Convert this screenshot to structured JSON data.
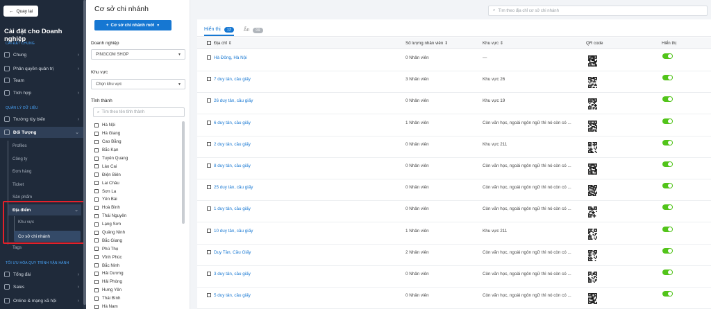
{
  "sidebar": {
    "back_label": "Quay lại",
    "title": "Cài đặt cho Doanh nghiệp",
    "section_general": "CÀI ĐẶT CHUNG",
    "general_items": [
      {
        "label": "Chung",
        "icon": "grid-icon"
      },
      {
        "label": "Phân quyền quản trị",
        "icon": "users-icon"
      },
      {
        "label": "Team",
        "icon": "team-icon"
      },
      {
        "label": "Tích hợp",
        "icon": "plug-icon"
      }
    ],
    "section_data": "QUẢN LÝ DỮ LIỆU",
    "data_items": [
      {
        "label": "Trường tùy biến",
        "icon": "field-icon"
      },
      {
        "label": "Đối Tượng",
        "icon": "box-icon"
      }
    ],
    "object_subitems": [
      "Profiles",
      "Công ty",
      "Đơn hàng",
      "Ticket",
      "Sản phẩm"
    ],
    "location_label": "Địa điểm",
    "location_subitems": [
      "Khu vực",
      "Cơ sở chi nhánh"
    ],
    "tags_label": "Tags",
    "section_ops": "TỐI ƯU HÓA QUY TRÌNH VẬN HÀNH",
    "ops_items": [
      {
        "label": "Tổng đài",
        "icon": "phone-icon"
      },
      {
        "label": "Sales",
        "icon": "sales-icon"
      },
      {
        "label": "Online & mạng xã hội",
        "icon": "globe-icon"
      }
    ]
  },
  "filter": {
    "title": "Cơ sở chi nhánh",
    "new_button": "Cơ sở chi nhánh mới",
    "company_label": "Doanh nghiệp",
    "company_value": "PINGCOM SHOP",
    "region_label": "Khu vực",
    "region_placeholder": "Chọn khu vực",
    "province_label": "Tỉnh thành",
    "province_search": "Tìm theo tên tỉnh thành",
    "provinces": [
      "Hà Nội",
      "Hà Giang",
      "Cao Bằng",
      "Bắc Kạn",
      "Tuyên Quang",
      "Lào Cai",
      "Điện Biên",
      "Lai Châu",
      "Sơn La",
      "Yên Bái",
      "Hoà Bình",
      "Thái Nguyên",
      "Lạng Sơn",
      "Quảng Ninh",
      "Bắc Giang",
      "Phú Thọ",
      "Vĩnh Phúc",
      "Bắc Ninh",
      "Hải Dương",
      "Hải Phòng",
      "Hưng Yên",
      "Thái Bình",
      "Hà Nam"
    ]
  },
  "main": {
    "search_placeholder": "Tìm theo địa chỉ cơ sở chi nhánh",
    "tabs": [
      {
        "label": "Hiển thị",
        "count": "13"
      },
      {
        "label": "Ẩn",
        "count": "09"
      }
    ],
    "columns": [
      "Địa chỉ",
      "Số lượng nhân viên",
      "Khu vực",
      "QR code",
      "Hiển thị"
    ],
    "rows": [
      {
        "address": "Hà Đông, Hà Nội",
        "employees": "0 Nhân viên",
        "area": "—",
        "visible": true
      },
      {
        "address": "7 duy tân, cầu giấy",
        "employees": "3 Nhân viên",
        "area": "Khu vực 26",
        "visible": true
      },
      {
        "address": "26 duy tân, cầu giấy",
        "employees": "0 Nhân viên",
        "area": "Khu vực 19",
        "visible": true
      },
      {
        "address": "6 duy tân, cầu giấy",
        "employees": "1 Nhân viên",
        "area": "Còn văn học, ngoài ngôn ngữ thì nó còn có ...",
        "visible": true
      },
      {
        "address": "2 duy tân, cầu giấy",
        "employees": "0 Nhân viên",
        "area": "Khu vực 211",
        "visible": true
      },
      {
        "address": "8 duy tân, cầu giấy",
        "employees": "0 Nhân viên",
        "area": "Còn văn học, ngoài ngôn ngữ thì nó còn có ...",
        "visible": true
      },
      {
        "address": "25 duy tân, cầu giấy",
        "employees": "0 Nhân viên",
        "area": "Còn văn học, ngoài ngôn ngữ thì nó còn có ...",
        "visible": true
      },
      {
        "address": "1 duy tân, cầu giấy",
        "employees": "0 Nhân viên",
        "area": "Còn văn học, ngoài ngôn ngữ thì nó còn có ...",
        "visible": true
      },
      {
        "address": "10 duy tân, cầu giấy",
        "employees": "1 Nhân viên",
        "area": "Khu vực 211",
        "visible": true
      },
      {
        "address": "Duy Tân, Cầu Giấy",
        "employees": "2 Nhân viên",
        "area": "Còn văn học, ngoài ngôn ngữ thì nó còn có ...",
        "visible": true
      },
      {
        "address": "3 duy tân, cầu giấy",
        "employees": "0 Nhân viên",
        "area": "Còn văn học, ngoài ngôn ngữ thì nó còn có ...",
        "visible": true
      },
      {
        "address": "5 duy tân, cầu giấy",
        "employees": "0 Nhân viên",
        "area": "Còn văn học, ngoài ngôn ngữ thì nó còn có ...",
        "visible": true
      }
    ]
  },
  "colors": {
    "accent": "#1677d2",
    "sidebar_bg": "#1f2a3a",
    "toggle_on": "#52c41a",
    "highlight": "#e4212a"
  }
}
